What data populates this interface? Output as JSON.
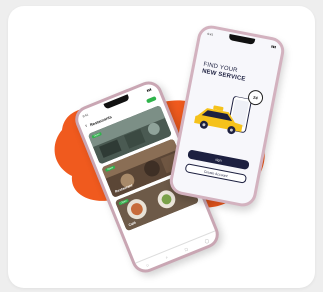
{
  "colors": {
    "background": "#eeeeee",
    "card": "#ffffff",
    "blob": "#f05a1e",
    "phone_frame": "#c9a6b3",
    "accent_green": "#2fb44b",
    "navy": "#1d2040",
    "taxi_yellow": "#f5c21b"
  },
  "left_phone": {
    "status_time": "9:41",
    "status_icons": "▮▮▮",
    "back_glyph": "‹",
    "header_title": "Restaurants",
    "cards": [
      {
        "tag": "Open",
        "name": ""
      },
      {
        "tag": "Open",
        "name": "Restaurant"
      },
      {
        "tag": "Open",
        "name": "Café"
      }
    ],
    "nav_icons": [
      "home-icon",
      "search-icon",
      "bag-icon",
      "user-icon"
    ],
    "nav_glyphs": [
      "⌂",
      "⌕",
      "◻",
      "◯"
    ]
  },
  "right_phone": {
    "status_time": "9:41",
    "status_icons": "▮▮▮",
    "title_line1": "FIND YOUR",
    "title_line2": "NEW SERVICE",
    "clock_label": "24",
    "signin_label": "sign",
    "create_label": "Create Account"
  }
}
